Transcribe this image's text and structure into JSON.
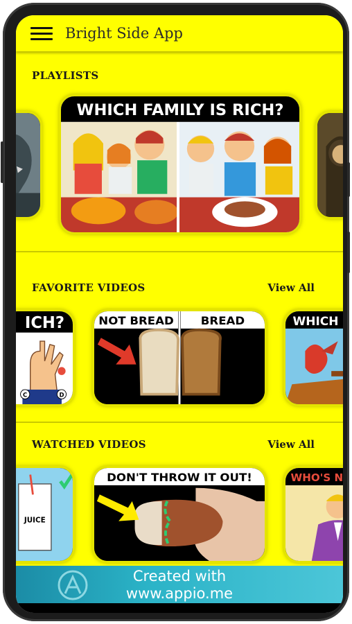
{
  "app": {
    "title": "Bright Side App"
  },
  "playlists": {
    "title": "PLAYLISTS",
    "cards": [
      {
        "icon": "dinosaur-thumbnail"
      },
      {
        "caption": "WHICH FAMILY IS RICH?"
      },
      {
        "icon": "mona-lisa-thumbnail"
      }
    ]
  },
  "favorite_videos": {
    "title": "FAVORITE VIDEOS",
    "view_all": "View All",
    "cards": [
      {
        "caption": "ICH?",
        "badges": [
          "C",
          "D"
        ]
      },
      {
        "caption_left": "NOT BREAD",
        "caption_right": "BREAD"
      },
      {
        "caption": "WHICH"
      }
    ]
  },
  "watched_videos": {
    "title": "WATCHED VIDEOS",
    "view_all": "View All",
    "cards": [
      {
        "caption": "JUICE"
      },
      {
        "caption": "DON'T THROW IT OUT!"
      },
      {
        "caption": "WHO'S N"
      }
    ]
  },
  "banner": {
    "line1": "Created with",
    "line2": "www.appio.me"
  },
  "colors": {
    "accent": "#ffff00",
    "banner": "#2bb3c7"
  }
}
